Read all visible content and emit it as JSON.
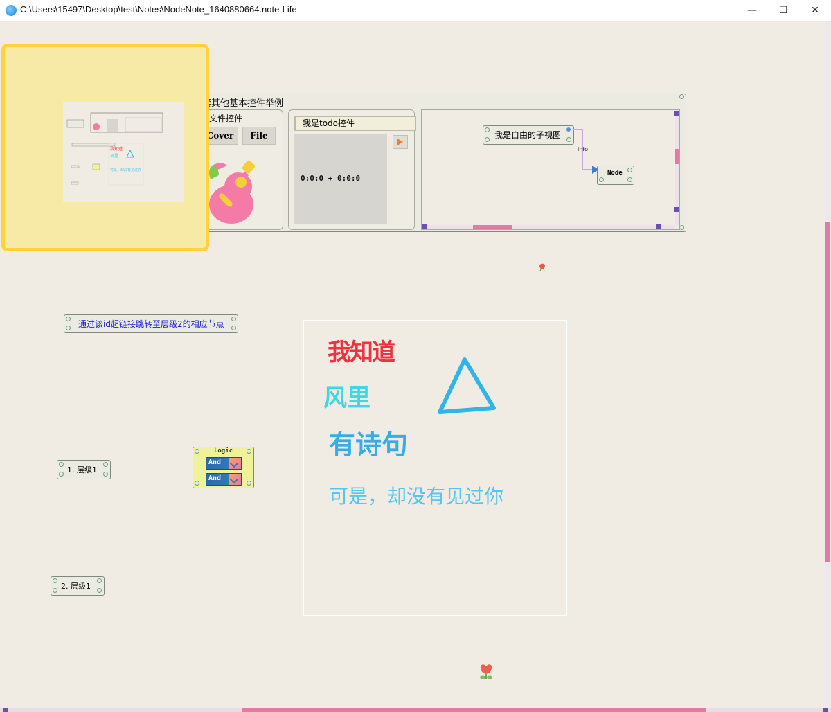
{
  "window": {
    "title": "C:\\Users\\15497\\Desktop\\test\\Notes\\NodeNote_1640880664.note-Life",
    "minimize": "—",
    "maximize": "☐",
    "close": "✕"
  },
  "group": {
    "title": "套其他基本控件举例",
    "file_panel": {
      "title": "暑文件控件",
      "cover_button": "Cover",
      "file_button": "File"
    },
    "todo_panel": {
      "title": "我是todo控件",
      "timer": "0:0:0 + 0:0:0"
    },
    "subview": {
      "child_node": "我是自由的子视图",
      "edge_label": "info",
      "target_node": "Node"
    }
  },
  "hyperlink_node": {
    "text": "通过该id超链接跳转至层级2的相应节点"
  },
  "logic_node": {
    "title": "Logic",
    "rows": [
      "And",
      "And"
    ]
  },
  "level_nodes": [
    {
      "label": "1. 层级1"
    },
    {
      "label": "2. 层级1"
    }
  ],
  "handwriting": {
    "line1": "我知道",
    "line2": "风里",
    "line3": "有诗句",
    "line4": "可是，却没有见过你",
    "colors": {
      "line1": "#ee3340",
      "line2": "#3fd6e6",
      "line3": "#35aee8",
      "line4": "#55c6f0",
      "triangle": "#30b5e8"
    }
  },
  "colors": {
    "canvas": "#f0ebe3",
    "minimap_fill": "#f7e9a6",
    "minimap_border": "#ffd23a",
    "scroll_thumb": "#e07aa6"
  }
}
